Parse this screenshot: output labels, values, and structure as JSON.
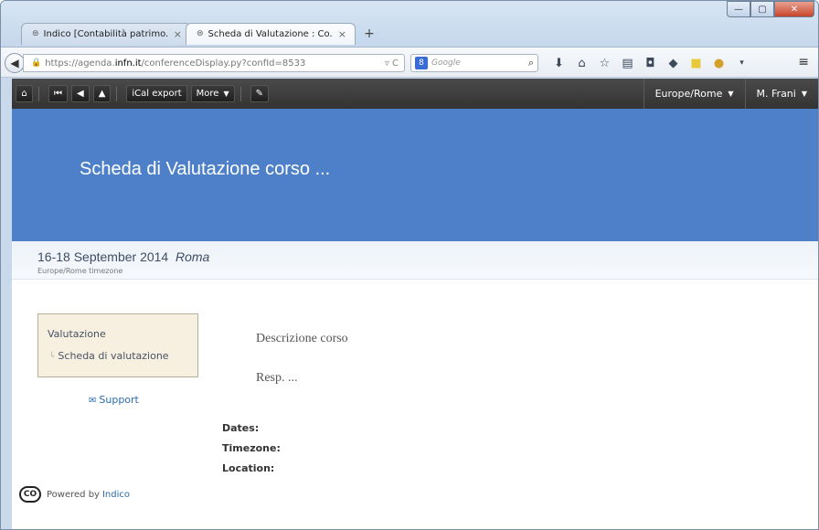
{
  "browser": {
    "tabs": [
      {
        "icon": "⊜",
        "label": "Indico [Contabilità patrimo...",
        "close": "×"
      },
      {
        "icon": "⊜",
        "label": "Scheda di Valutazione : Co...",
        "close": "×"
      }
    ],
    "new_tab": "+",
    "url": {
      "prefix": "https://agenda.",
      "host": "infn.it",
      "path": "/conferenceDisplay.py?confId=8533"
    },
    "search_placeholder": "Google",
    "window_controls": {
      "minimize": "—",
      "maximize": "▢",
      "close": "✕"
    }
  },
  "indico_toolbar": {
    "home_icon": "⌂",
    "first_icon": "⏮",
    "prev_icon": "◀",
    "up_icon": "▲",
    "ical_label": "iCal export",
    "more_label": "More",
    "edit_icon": "✎",
    "timezone_label": "Europe/Rome",
    "user_label": "M. Frani"
  },
  "event": {
    "title": "Scheda di Valutazione  corso ...",
    "dates": "16-18 September 2014",
    "location": "Roma",
    "timezone_note": "Europe/Rome timezone",
    "description": "Descrizione corso",
    "resp": "Resp. ...",
    "info_labels": [
      "Dates:",
      "Timezone:",
      "Location:"
    ]
  },
  "sidebar": {
    "heading": "Valutazione",
    "items": [
      {
        "label": "Scheda di valutazione"
      }
    ],
    "support_label": "Support"
  },
  "footer": {
    "powered_by": "Powered by",
    "link": "Indico",
    "logo_text": "CO"
  }
}
